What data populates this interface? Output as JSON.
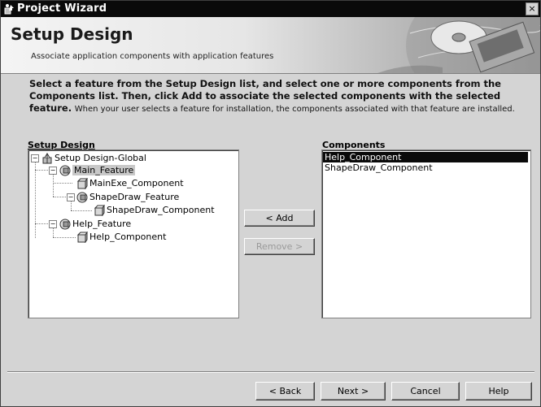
{
  "window": {
    "title": "Project Wizard",
    "close_glyph": "×"
  },
  "banner": {
    "heading": "Setup Design",
    "subheading": "Associate application components with application features"
  },
  "instructions": {
    "bold": "Select a feature from the Setup Design list, and select one or more components from the Components list. Then, click Add to associate the selected components with the selected feature.",
    "normal": "When your user selects a feature for installation, the components associated with that feature are installed."
  },
  "setup_design": {
    "label": "Setup Design",
    "nodes": [
      {
        "text": "Setup Design-Global",
        "icon": "setup-global-icon"
      },
      {
        "text": "Main_Feature",
        "icon": "feature-icon",
        "selected": true
      },
      {
        "text": "MainExe_Component",
        "icon": "component-icon"
      },
      {
        "text": "ShapeDraw_Feature",
        "icon": "feature-icon"
      },
      {
        "text": "ShapeDraw_Component",
        "icon": "component-icon"
      },
      {
        "text": "Help_Feature",
        "icon": "feature-icon"
      },
      {
        "text": "Help_Component",
        "icon": "component-icon"
      }
    ]
  },
  "components": {
    "label": "Components",
    "items": [
      {
        "text": "Help_Component",
        "selected": true
      },
      {
        "text": "ShapeDraw_Component",
        "selected": false
      }
    ]
  },
  "buttons": {
    "add": "< Add",
    "remove": "Remove >",
    "back": "< Back",
    "next": "Next >",
    "cancel": "Cancel",
    "help": "Help"
  },
  "expanders": {
    "collapse": "−"
  }
}
